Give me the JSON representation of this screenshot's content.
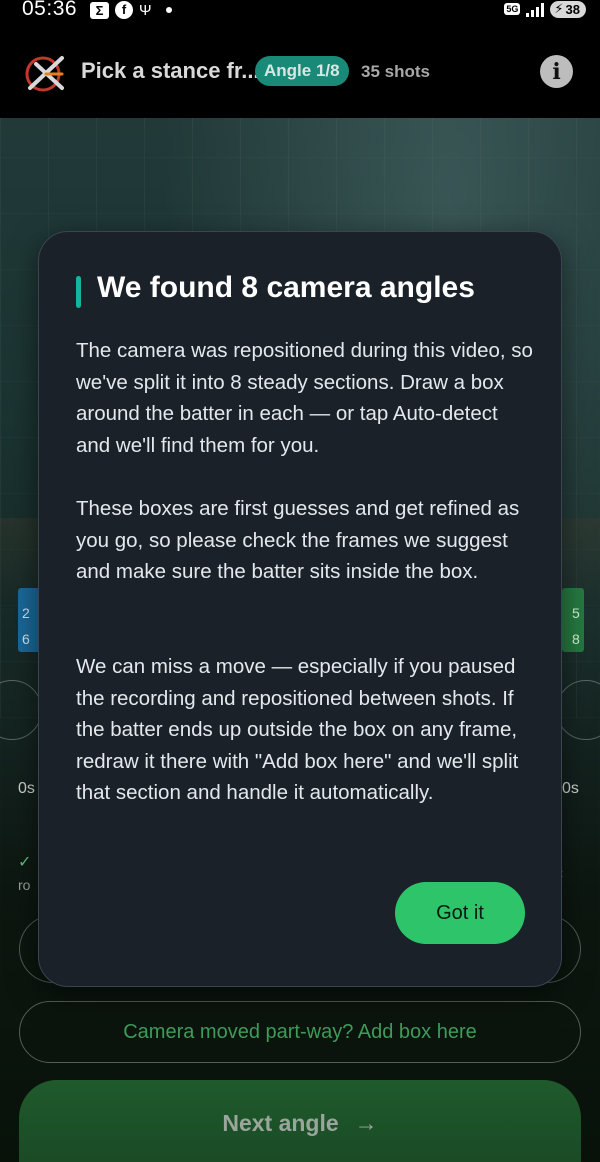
{
  "status_bar": {
    "time": "05:36",
    "left_icons": [
      "sigma-icon",
      "facebook-icon",
      "usb-icon",
      "dot-icon"
    ],
    "sigma_glyph": "Σ",
    "facebook_glyph": "f",
    "usb_glyph": "Ψ",
    "network_badge": "5G",
    "battery_level": "38",
    "battery_bolt": "⚡"
  },
  "header": {
    "title": "Pick a stance fr...",
    "angle_badge": "Angle 1/8",
    "shots": "35 shots",
    "info_glyph": "i"
  },
  "background": {
    "left_pill_text": "2\n6",
    "right_pill_text": "5\n8",
    "time_left": "0s",
    "time_right": "0s",
    "check_glyph": "✓",
    "ro_text": "ro",
    "arrow_glyph": "‹",
    "add_box_label": "Camera moved part-way? Add box here",
    "next_angle_label": "Next angle",
    "next_arrow": "→"
  },
  "modal": {
    "title": "We found 8 camera angles",
    "paragraph_1": "The camera was repositioned during this video, so we've split it into 8 steady sections. Draw a box around the batter in each — or tap Auto-detect and we'll find them for you.",
    "paragraph_2": "These boxes are first guesses and get refined as you go, so please check the frames we suggest and make sure the batter sits inside the box.",
    "paragraph_3": "We can miss a move — especially if you paused the recording and repositioned between shots. If the batter ends up outside the box on any frame, redraw it there with \"Add box here\" and we'll split that section and handle it automatically.",
    "confirm_label": "Got it"
  },
  "colors": {
    "accent_teal": "#15b3a0",
    "badge_teal": "#1a8a78",
    "confirm_green": "#2ec46a",
    "modal_bg": "#1a2129"
  }
}
